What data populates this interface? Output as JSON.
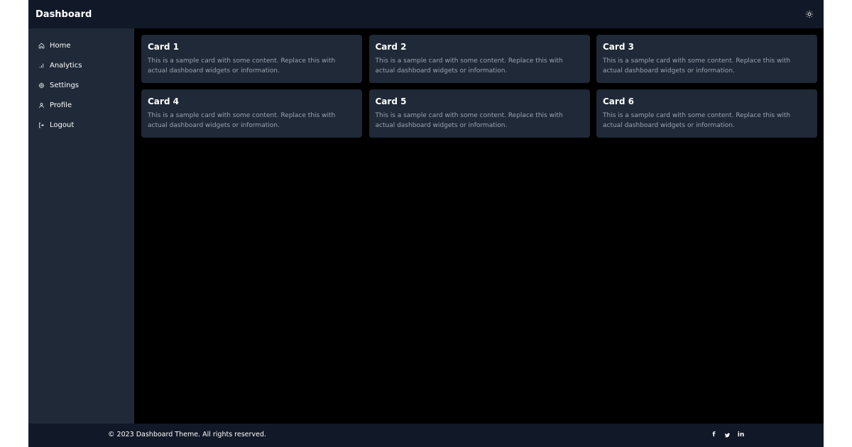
{
  "header": {
    "title": "Dashboard",
    "theme_icon": "sun-icon"
  },
  "sidebar": {
    "items": [
      {
        "label": "Home",
        "icon": "home-icon"
      },
      {
        "label": "Analytics",
        "icon": "bar-chart-icon"
      },
      {
        "label": "Settings",
        "icon": "gear-icon"
      },
      {
        "label": "Profile",
        "icon": "user-icon"
      },
      {
        "label": "Logout",
        "icon": "logout-icon"
      }
    ]
  },
  "cards": [
    {
      "title": "Card 1",
      "text": "This is a sample card with some content. Replace this with actual dashboard widgets or information."
    },
    {
      "title": "Card 2",
      "text": "This is a sample card with some content. Replace this with actual dashboard widgets or information."
    },
    {
      "title": "Card 3",
      "text": "This is a sample card with some content. Replace this with actual dashboard widgets or information."
    },
    {
      "title": "Card 4",
      "text": "This is a sample card with some content. Replace this with actual dashboard widgets or information."
    },
    {
      "title": "Card 5",
      "text": "This is a sample card with some content. Replace this with actual dashboard widgets or information."
    },
    {
      "title": "Card 6",
      "text": "This is a sample card with some content. Replace this with actual dashboard widgets or information."
    }
  ],
  "footer": {
    "copyright": "© 2023 Dashboard Theme. All rights reserved.",
    "social": [
      {
        "label": "f",
        "icon": "facebook-icon"
      },
      {
        "label": "🐦",
        "icon": "twitter-icon"
      },
      {
        "label": "in",
        "icon": "linkedin-icon"
      }
    ]
  },
  "colors": {
    "topbar": "#111827",
    "sidebar": "#1f2937",
    "card": "#1f2937",
    "main": "#000000",
    "muted_text": "#9ca3af"
  }
}
